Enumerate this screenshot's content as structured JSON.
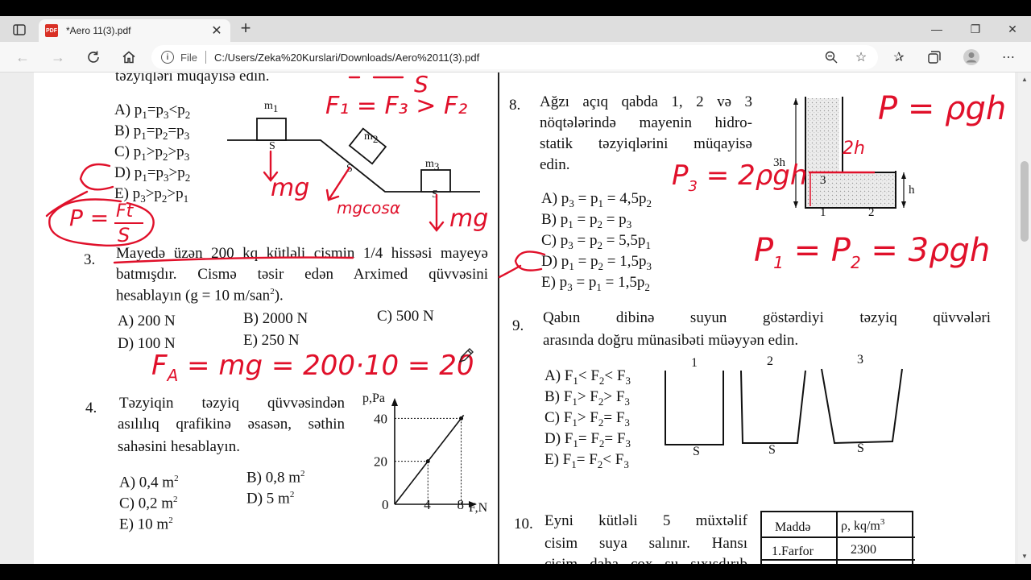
{
  "browser": {
    "tab": {
      "title": "*Aero 11(3).pdf",
      "badge": "PDF"
    },
    "address": {
      "scheme_label": "File",
      "url": "C:/Users/Zeka%20Kurslari/Downloads/Aero%2011(3).pdf"
    }
  },
  "doc": {
    "q2": {
      "header": "təzyiqləri müqayisə edin.",
      "options": [
        {
          "letter": "A) p",
          "s1": "1",
          "m1": "=p",
          "s2": "3",
          "m2": "<p",
          "s3": "2"
        },
        {
          "letter": "B) p",
          "s1": "1",
          "m1": "=p",
          "s2": "2",
          "m2": "=p",
          "s3": "3"
        },
        {
          "letter": "C) p",
          "s1": "1",
          "m1": ">p",
          "s2": "2",
          "m2": ">p",
          "s3": "3"
        },
        {
          "letter": "D) p",
          "s1": "1",
          "m1": "=p",
          "s2": "3",
          "m2": ">p",
          "s3": "2"
        },
        {
          "letter": "E) p",
          "s1": "3",
          "m1": ">p",
          "s2": "2",
          "m2": ">p",
          "s3": "1"
        }
      ],
      "labels": {
        "m1": "m",
        "m1_sub": "1",
        "m2": "m",
        "m2_sub": "2",
        "m3": "m",
        "m3_sub": "3",
        "s": "S"
      }
    },
    "q3": {
      "num": "3.",
      "line1": "Mayedə üzən 200 kq kütləli cismin 1/4 hissəsi mayeyə",
      "line2": "batmışdır. Cismə təsir edən Arximed qüvvəsini",
      "line3": "hesablayın (g = 10 m/san",
      "line3_sup": "2",
      "line3_end": ").",
      "options": [
        "A) 200 N",
        "B) 2000 N",
        "C) 500 N",
        "D) 100 N",
        "E) 250 N"
      ]
    },
    "q4": {
      "num": "4.",
      "line1": "Təzyiqin təzyiq qüvvəsindən",
      "line2": "asılılıq qrafikinə əsasən, səthin",
      "line3": "sahəsini hesablayın.",
      "options": [
        {
          "text": "A) 0,4 m",
          "sup": "2"
        },
        {
          "text": "B) 0,8 m",
          "sup": "2"
        },
        {
          "text": "C) 0,2 m",
          "sup": "2"
        },
        {
          "text": "D) 5 m",
          "sup": "2"
        },
        {
          "text": "E) 10 m",
          "sup": "2"
        }
      ]
    },
    "q8": {
      "num": "8.",
      "line1": "Ağzı açıq qabda 1, 2 və 3",
      "line2": "nöqtələrində mayenin hidro-",
      "line3": "statik təzyiqlərini müqayisə",
      "line4": "edin.",
      "options": [
        {
          "a": "A) p",
          "s1": "3",
          "b": " = p",
          "s2": "1",
          "c": " = 4,5p",
          "s3": "2"
        },
        {
          "a": "B) p",
          "s1": "1",
          "b": " = p",
          "s2": "2",
          "c": " = p",
          "s3": "3"
        },
        {
          "a": "C) p",
          "s1": "3",
          "b": " = p",
          "s2": "2",
          "c": " = 5,5p",
          "s3": "1"
        },
        {
          "a": "D) p",
          "s1": "1",
          "b": " = p",
          "s2": "2",
          "c": " = 1,5p",
          "s3": "3"
        },
        {
          "a": "E) p",
          "s1": "3",
          "b": " = p",
          "s2": "1",
          "c": " = 1,5p",
          "s3": "2"
        }
      ],
      "figure": {
        "h3": "3h",
        "h": "h",
        "p1": "1",
        "p2": "2",
        "p3": "3"
      }
    },
    "q9": {
      "num": "9.",
      "line1": "Qabın dibinə suyun göstərdiyi təzyiq qüvvələri",
      "line2": "arasında doğru münasibəti müəyyən edin.",
      "options": [
        {
          "a": "A) F",
          "s1": "1",
          "b": "< F",
          "s2": "2",
          "c": "< F",
          "s3": "3"
        },
        {
          "a": "B) F",
          "s1": "1",
          "b": "> F",
          "s2": "2",
          "c": "> F",
          "s3": "3"
        },
        {
          "a": "C) F",
          "s1": "1",
          "b": "> F",
          "s2": "2",
          "c": "= F",
          "s3": "3"
        },
        {
          "a": "D) F",
          "s1": "1",
          "b": "= F",
          "s2": "2",
          "c": "= F",
          "s3": "3"
        },
        {
          "a": "E) F",
          "s1": "1",
          "b": "= F",
          "s2": "2",
          "c": "< F",
          "s3": "3"
        }
      ],
      "vessels": {
        "n1": "1",
        "n2": "2",
        "n3": "3",
        "s": "S"
      }
    },
    "q10": {
      "num": "10.",
      "line1": "Eyni kütləli 5 müxtəlif",
      "line2": "cisim suya salınır. Hansı",
      "line3": "cisim daha çox su sıxışdırıb",
      "table": {
        "h1": "Maddə",
        "h2": "ρ, kq/m",
        "h2_sup": "3",
        "r1c1": "1.Farfor",
        "r1c2": "2300"
      }
    }
  },
  "chart_data": {
    "type": "line",
    "xlabel": "F,N",
    "ylabel": "p,Pa",
    "x": [
      0,
      4,
      8
    ],
    "y": [
      0,
      20,
      40
    ],
    "x_ticks": [
      "0",
      "4",
      "8"
    ],
    "y_ticks": [
      "20",
      "40"
    ],
    "xlim": [
      0,
      9.5
    ],
    "ylim": [
      0,
      48
    ]
  },
  "annotations": {
    "eq_top": "F₁ = F₃ > F₂",
    "frac_top": "S",
    "p_top_left": "P =",
    "p_frac_num": "Ft",
    "p_frac_den": "S",
    "mg1": "mg",
    "mgcos": "mgcosα",
    "mg3": "mg",
    "fa": "F",
    "fa_sub": "A",
    "fa_rest": " = mg = 200·10 = 20",
    "pgh": "P = ρgh",
    "p3": "P",
    "p3_sub": "3",
    "p3_rest": " = 2ρgh",
    "p12": "P",
    "p12_s1": "1",
    "p12_mid": " = P",
    "p12_s2": "2",
    "p12_rest": " = 3ρgh",
    "label_2h": "2h"
  }
}
